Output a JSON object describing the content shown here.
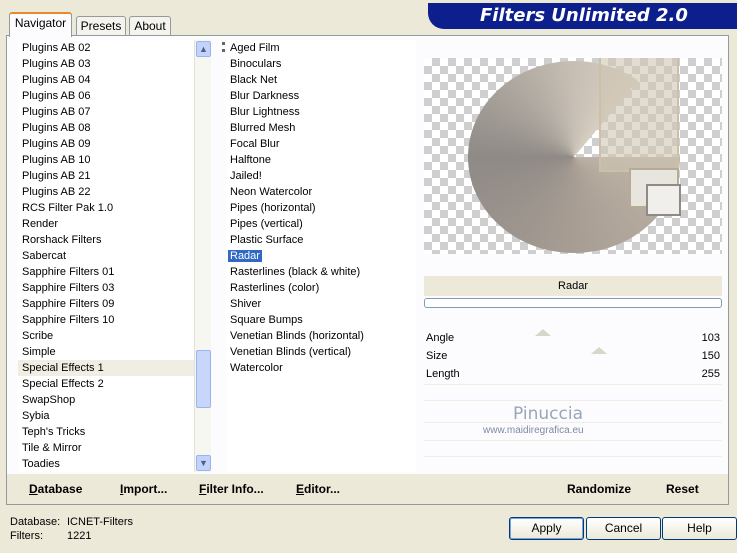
{
  "app": {
    "title": "Filters Unlimited 2.0"
  },
  "tabs": [
    {
      "label": "Navigator",
      "active": true
    },
    {
      "label": "Presets",
      "active": false
    },
    {
      "label": "About",
      "active": false
    }
  ],
  "categories": {
    "items": [
      "Plugins AB 02",
      "Plugins AB 03",
      "Plugins AB 04",
      "Plugins AB 06",
      "Plugins AB 07",
      "Plugins AB 08",
      "Plugins AB 09",
      "Plugins AB 10",
      "Plugins AB 21",
      "Plugins AB 22",
      "RCS Filter Pak 1.0",
      "Render",
      "Rorshack Filters",
      "Sabercat",
      "Sapphire Filters 01",
      "Sapphire Filters 03",
      "Sapphire Filters 09",
      "Sapphire Filters 10",
      "Scribe",
      "Simple",
      "Special Effects 1",
      "Special Effects 2",
      "SwapShop",
      "Sybia",
      "Teph's Tricks",
      "Tile & Mirror",
      "Toadies"
    ],
    "selected": "Special Effects 1"
  },
  "filters": {
    "items": [
      "Aged Film",
      "Binoculars",
      "Black Net",
      "Blur Darkness",
      "Blur Lightness",
      "Blurred Mesh",
      "Focal Blur",
      "Halftone",
      "Jailed!",
      "Neon Watercolor",
      "Pipes (horizontal)",
      "Pipes (vertical)",
      "Plastic Surface",
      "Radar",
      "Rasterlines (black & white)",
      "Rasterlines (color)",
      "Shiver",
      "Square Bumps",
      "Venetian Blinds (horizontal)",
      "Venetian Blinds (vertical)",
      "Watercolor"
    ],
    "selected": "Radar"
  },
  "preview": {
    "filter_name": "Radar",
    "progress": 0
  },
  "parameters": [
    {
      "label": "Angle",
      "value": "103"
    },
    {
      "label": "Size",
      "value": "150"
    },
    {
      "label": "Length",
      "value": "255"
    }
  ],
  "watermark": {
    "name": "Pinuccia",
    "url": "www.maidiregrafica.eu"
  },
  "toolbar": {
    "database": "Database",
    "import": "Import...",
    "filter_info": "Filter Info...",
    "editor": "Editor...",
    "randomize": "Randomize",
    "reset": "Reset"
  },
  "status": {
    "database_label": "Database:",
    "database_value": "ICNET-Filters",
    "filters_label": "Filters:",
    "filters_value": "1221"
  },
  "actions": {
    "apply": "Apply",
    "cancel": "Cancel",
    "help": "Help"
  },
  "icons": {
    "scroll_up": "chevron-up-icon",
    "scroll_down": "chevron-down-icon"
  }
}
